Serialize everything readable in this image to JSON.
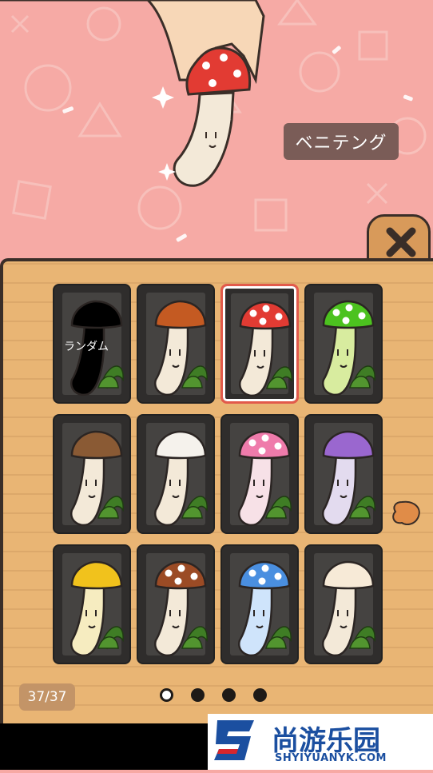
{
  "selected_name": "ベニテング",
  "random_label": "ランダム",
  "counter": "37/37",
  "pages": {
    "total": 4,
    "current": 1
  },
  "colors": {
    "background_pink": "#f6aaa5",
    "panel_wood": "#e9b574",
    "selected_border": "#e25a4b",
    "slot_dark": "#2f2d2c"
  },
  "mushrooms": [
    {
      "name": "random",
      "cap": "#000000",
      "stem": "#000000",
      "spots": false
    },
    {
      "name": "shiitake-brown",
      "cap": "#c45a22",
      "stem": "#f3e9d8",
      "spots": false
    },
    {
      "name": "benitengu",
      "cap": "#e23b33",
      "stem": "#f3e9d8",
      "spots": true
    },
    {
      "name": "green",
      "cap": "#4cc21f",
      "stem": "#d8ec9f",
      "spots": true
    },
    {
      "name": "eringi",
      "cap": "#8a5a34",
      "stem": "#f3e9d8",
      "spots": false
    },
    {
      "name": "hairy",
      "cap": "#f5f2ec",
      "stem": "#f3e9d8",
      "spots": false
    },
    {
      "name": "pink",
      "cap": "#ef7bab",
      "stem": "#f7e1e7",
      "spots": true
    },
    {
      "name": "purple",
      "cap": "#9a67cf",
      "stem": "#e3dbef",
      "spots": false
    },
    {
      "name": "yellow",
      "cap": "#f1c21c",
      "stem": "#f6ecc0",
      "spots": false
    },
    {
      "name": "matsutake",
      "cap": "#9b4b25",
      "stem": "#f3e9d8",
      "spots": true
    },
    {
      "name": "blue",
      "cap": "#4a8fe0",
      "stem": "#cfe4fb",
      "spots": true
    },
    {
      "name": "white-cap",
      "cap": "#f7ead7",
      "stem": "#f3e9d8",
      "spots": false
    }
  ]
}
